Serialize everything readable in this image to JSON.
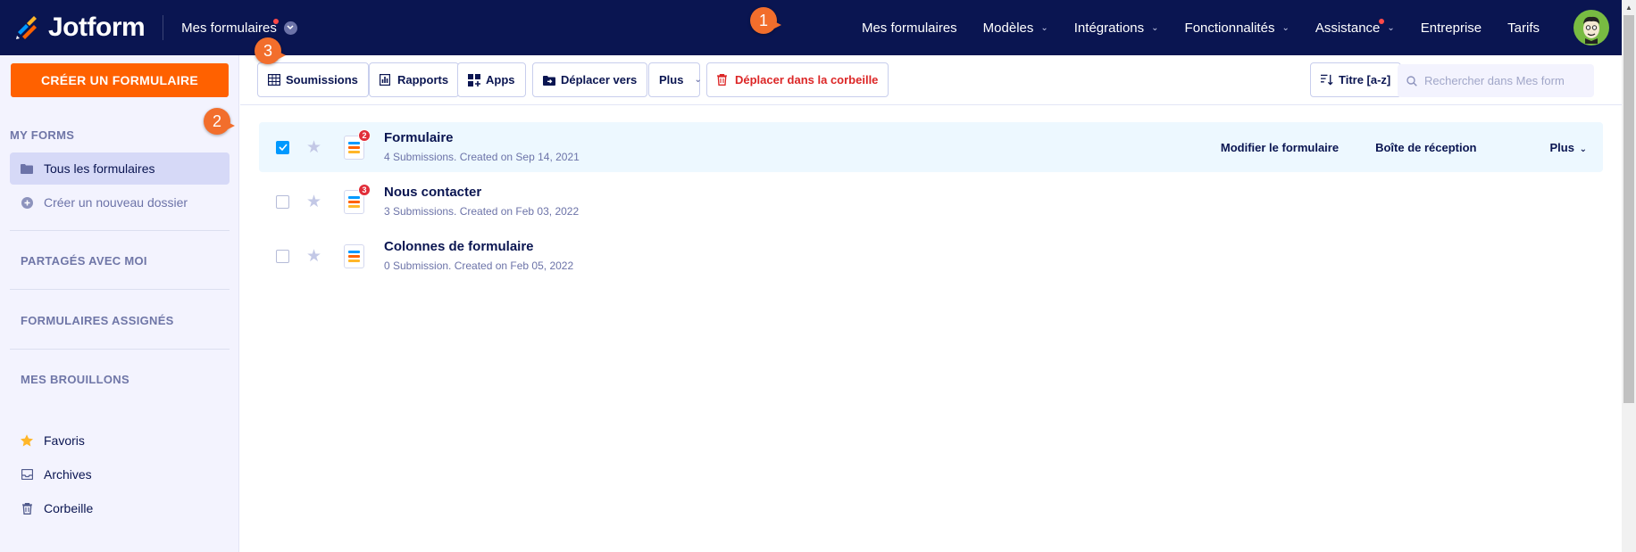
{
  "topbar": {
    "brand": "Jotform",
    "workspace": "Mes formulaires",
    "nav": [
      {
        "label": "Mes formulaires",
        "caret": false,
        "dot": false
      },
      {
        "label": "Modèles",
        "caret": true,
        "dot": false
      },
      {
        "label": "Intégrations",
        "caret": true,
        "dot": false
      },
      {
        "label": "Fonctionnalités",
        "caret": true,
        "dot": false
      },
      {
        "label": "Assistance",
        "caret": true,
        "dot": true
      },
      {
        "label": "Entreprise",
        "caret": false,
        "dot": false
      },
      {
        "label": "Tarifs",
        "caret": false,
        "dot": false
      }
    ]
  },
  "annotations": {
    "step1": "1",
    "step2": "2",
    "step3": "3"
  },
  "sidebar": {
    "create_label": "CRÉER UN FORMULAIRE",
    "my_forms_heading": "MY FORMS",
    "all_forms": "Tous les formulaires",
    "new_folder": "Créer un nouveau dossier",
    "shared": "PARTAGÉS AVEC MOI",
    "assigned": "FORMULAIRES ASSIGNÉS",
    "drafts": "MES BROUILLONS",
    "favorites": "Favoris",
    "archives": "Archives",
    "trash": "Corbeille"
  },
  "toolbar": {
    "submissions": "Soumissions",
    "reports": "Rapports",
    "apps": "Apps",
    "move_to": "Déplacer vers",
    "more": "Plus",
    "move_trash": "Déplacer dans la corbeille",
    "sort": "Titre [a-z]",
    "search_placeholder": "Rechercher dans Mes form"
  },
  "forms": [
    {
      "title": "Formulaire",
      "meta": "4 Submissions. Created on Sep 14, 2021",
      "badge": "2",
      "selected": true
    },
    {
      "title": "Nous contacter",
      "meta": "3 Submissions. Created on Feb 03, 2022",
      "badge": "3",
      "selected": false
    },
    {
      "title": "Colonnes de formulaire",
      "meta": "0 Submission. Created on Feb 05, 2022",
      "badge": "",
      "selected": false
    }
  ],
  "row_actions": {
    "edit": "Modifier le formulaire",
    "inbox": "Boîte de réception",
    "more": "Plus"
  },
  "colors": {
    "navy": "#0a1551",
    "orange": "#ff6100",
    "badge_orange": "#f26e2c",
    "selected_row": "#edf8ff",
    "checkbox": "#0099ff"
  }
}
